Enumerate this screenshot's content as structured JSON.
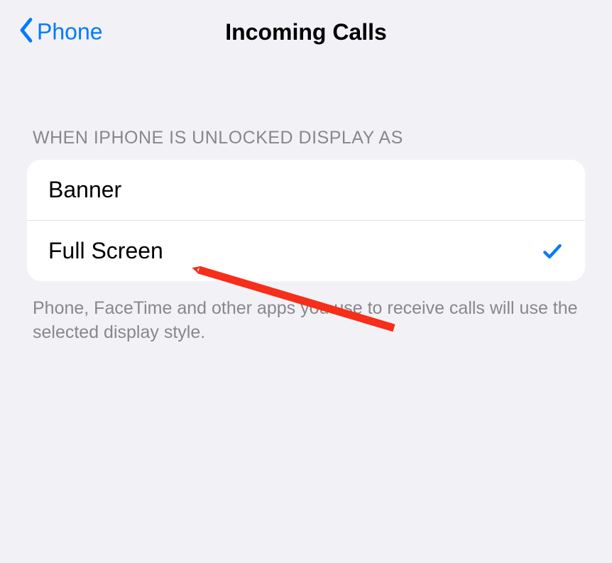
{
  "nav": {
    "back_label": "Phone",
    "title": "Incoming Calls"
  },
  "section": {
    "header": "WHEN IPHONE IS UNLOCKED DISPLAY AS",
    "footer": "Phone, FaceTime and other apps you use to receive calls will use the selected display style.",
    "options": [
      {
        "label": "Banner",
        "selected": false
      },
      {
        "label": "Full Screen",
        "selected": true
      }
    ]
  },
  "colors": {
    "accent": "#007aff",
    "bg": "#f2f2f6",
    "annotation": "#f62e1a"
  }
}
